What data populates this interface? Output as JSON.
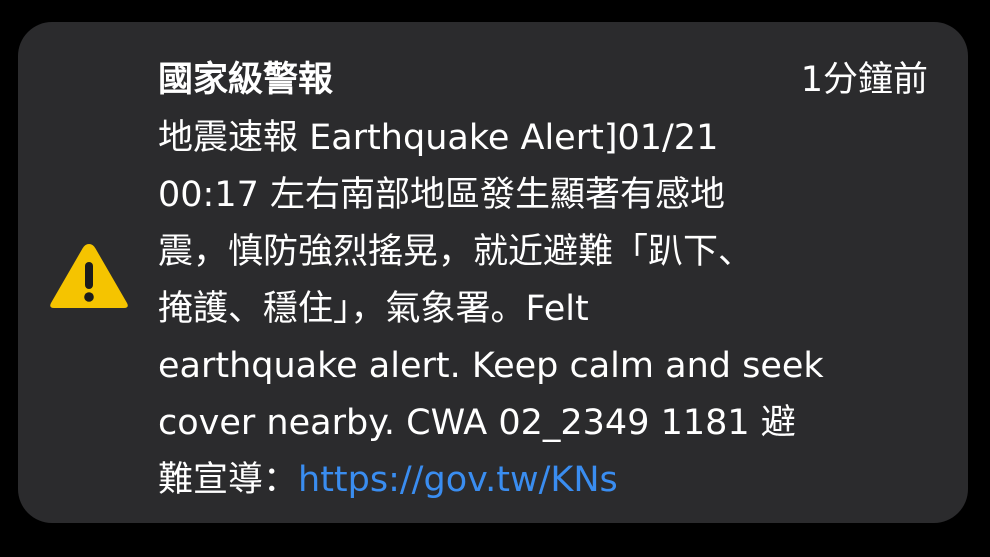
{
  "notification": {
    "title": "國家級警報",
    "time": "1分鐘前",
    "message_lines": [
      "地震速報 Earthquake Alert]01/21",
      "00:17 左右南部地區發生顯著有感地",
      "震，慎防強烈搖晃，就近避難「趴下、",
      "掩護、穩住」，氣象署。Felt",
      "earthquake alert. Keep calm and seek",
      "cover nearby. CWA 02_2349 1181 避"
    ],
    "last_line_prefix": "難宣導：",
    "link_text": "https://gov.tw/KNs",
    "icon": "warning-triangle-icon",
    "colors": {
      "card_background": "#2b2b2d",
      "text": "#ffffff",
      "link": "#3a8df0",
      "warning": "#f5c400"
    }
  }
}
